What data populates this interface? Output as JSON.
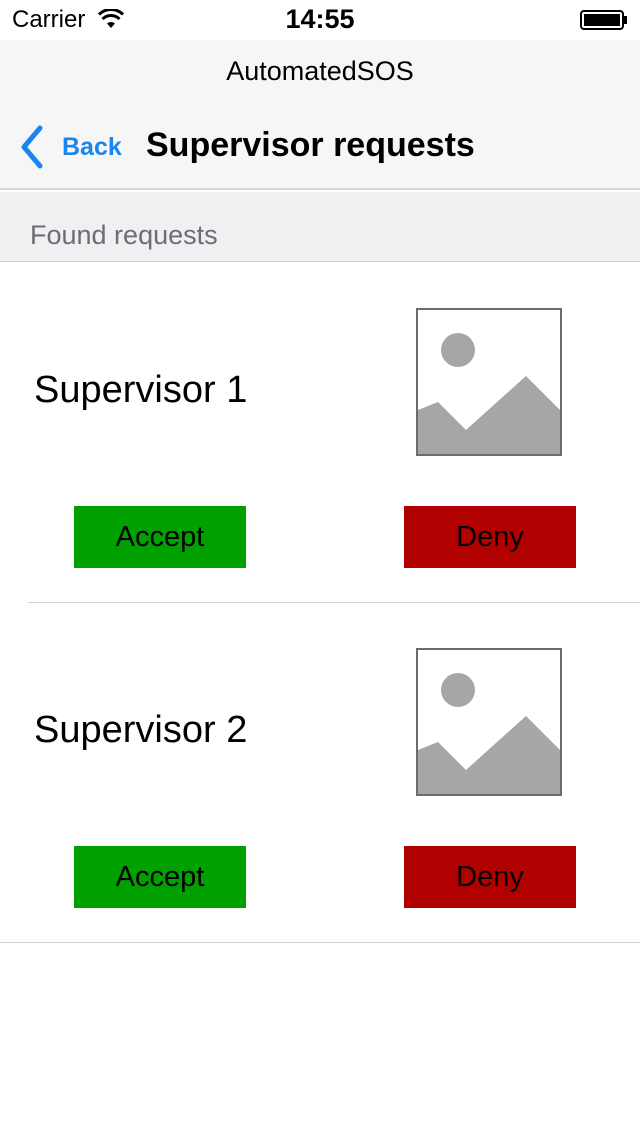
{
  "status_bar": {
    "carrier": "Carrier",
    "time": "14:55",
    "icons": [
      "wifi-icon",
      "battery-icon"
    ]
  },
  "nav": {
    "app_title": "AutomatedSOS",
    "back_label": "Back",
    "screen_title": "Supervisor requests",
    "accent_color": "#1a84f0"
  },
  "section": {
    "label": "Found requests"
  },
  "requests": [
    {
      "name": "Supervisor 1",
      "accept_label": "Accept",
      "deny_label": "Deny",
      "image_icon": "image-placeholder-icon"
    },
    {
      "name": "Supervisor 2",
      "accept_label": "Accept",
      "deny_label": "Deny",
      "image_icon": "image-placeholder-icon"
    }
  ],
  "colors": {
    "accept": "#00a000",
    "deny": "#b00000"
  }
}
